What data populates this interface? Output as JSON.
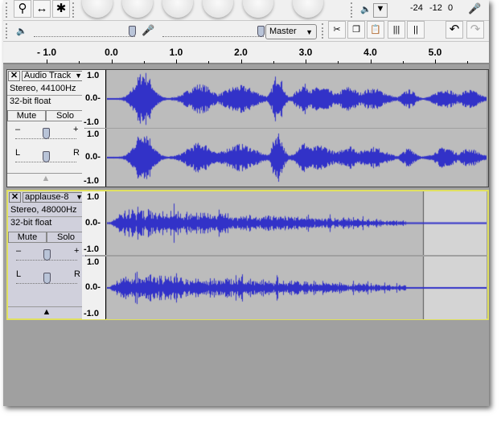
{
  "toolbar": {
    "tools": [
      {
        "icon": "zoom-icon",
        "glyph": "⚲"
      },
      {
        "icon": "timeshift-icon",
        "glyph": "↔"
      },
      {
        "icon": "multi-tool-icon",
        "glyph": "✱"
      }
    ],
    "meter_labels": [
      "-24",
      "-12",
      "0"
    ],
    "mixer": {
      "playback_icon": "speaker-icon",
      "record_icon": "microphone-icon",
      "input_source": "Master"
    },
    "edit_tools": [
      "trim-icon",
      "copy-icon",
      "paste-icon",
      "silence-icon",
      "trim-audio-icon",
      "undo-icon",
      "redo-icon"
    ]
  },
  "ruler": {
    "labels": [
      "- 1.0",
      "0.0",
      "1.0",
      "2.0",
      "3.0",
      "4.0",
      "5.0"
    ]
  },
  "tracks": [
    {
      "name": "Audio Track",
      "format": "Stereo, 44100Hz",
      "bits": "32-bit float",
      "mute": "Mute",
      "solo": "Solo",
      "gain_min": "–",
      "gain_max": "+",
      "pan_left": "L",
      "pan_right": "R",
      "selected": false
    },
    {
      "name": "applause-8",
      "format": "Stereo, 48000Hz",
      "bits": "32-bit float",
      "mute": "Mute",
      "solo": "Solo",
      "gain_min": "–",
      "gain_max": "+",
      "pan_left": "L",
      "pan_right": "R",
      "selected": true
    }
  ],
  "scale": {
    "top": "1.0",
    "mid": "0.0-",
    "bottom": "-1.0"
  },
  "colors": {
    "wave": "#3232c8",
    "wave_bg": "#bcbcbc",
    "selected_border": "#e0e060"
  }
}
